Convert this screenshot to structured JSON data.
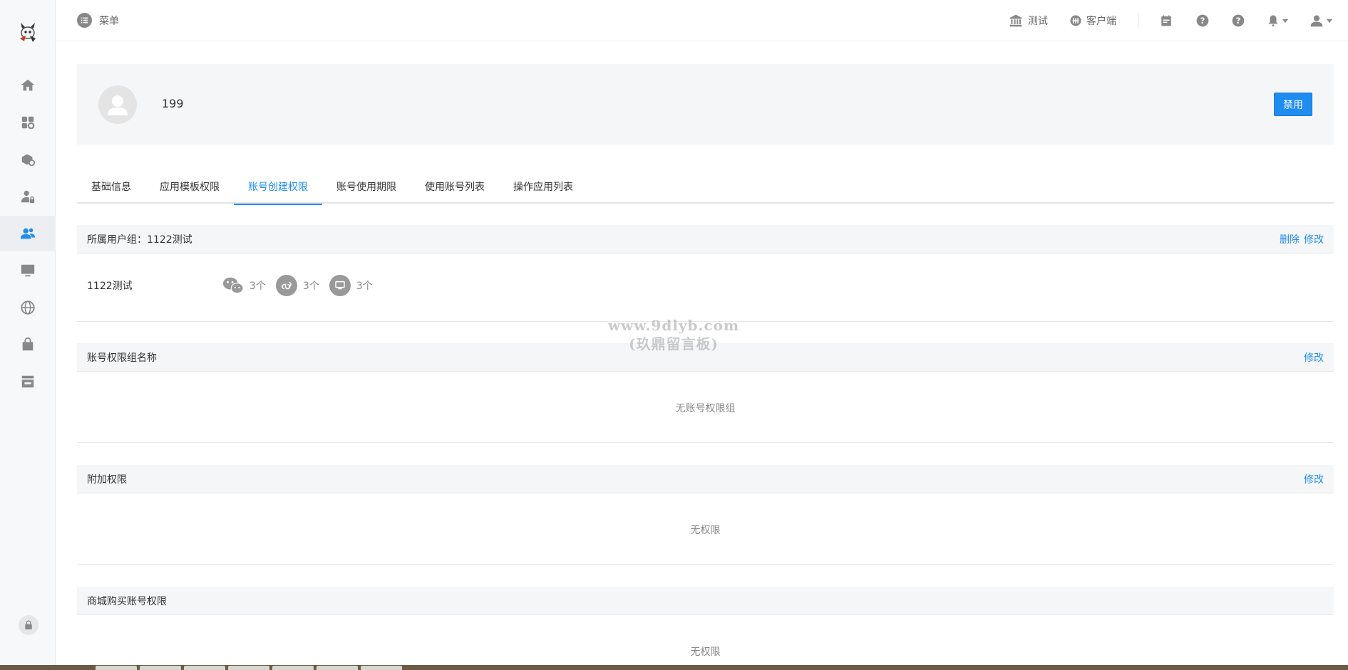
{
  "header": {
    "menu_label": "菜单",
    "links": [
      {
        "label": "测试",
        "icon": "bank-icon"
      },
      {
        "label": "客户端",
        "icon": "client-icon"
      }
    ]
  },
  "sidebar": {
    "items": [
      {
        "name": "home-icon"
      },
      {
        "name": "apps-settings-icon"
      },
      {
        "name": "package-settings-icon"
      },
      {
        "name": "user-lock-icon"
      },
      {
        "name": "users-icon",
        "active": true
      },
      {
        "name": "monitor-icon"
      },
      {
        "name": "globe-icon"
      },
      {
        "name": "bag-icon"
      },
      {
        "name": "store-icon"
      }
    ]
  },
  "profile": {
    "name": "199",
    "disable_label": "禁用"
  },
  "tabs": [
    {
      "label": "基础信息"
    },
    {
      "label": "应用模板权限"
    },
    {
      "label": "账号创建权限",
      "active": true
    },
    {
      "label": "账号使用期限"
    },
    {
      "label": "使用账号列表"
    },
    {
      "label": "操作应用列表"
    }
  ],
  "sections": {
    "group": {
      "title": "所属用户组：1122测试",
      "delete_label": "删除",
      "edit_label": "修改",
      "row_name": "1122测试",
      "caps": [
        {
          "icon": "wechat-icon",
          "count": "3个"
        },
        {
          "icon": "miniprogram-icon",
          "count": "3个"
        },
        {
          "icon": "pc-icon",
          "count": "3个"
        }
      ]
    },
    "perm_group": {
      "title": "账号权限组名称",
      "edit_label": "修改",
      "empty": "无账号权限组"
    },
    "extra": {
      "title": "附加权限",
      "edit_label": "修改",
      "empty": "无权限"
    },
    "mall": {
      "title": "商城购买账号权限",
      "empty": "无权限"
    }
  },
  "watermark": {
    "line1": "www.9dlyb.com",
    "line2": "(玖鼎留言板)"
  },
  "colors": {
    "accent": "#1e8cf0",
    "sidebar_bg": "#f7f8fa",
    "section_bg": "#f5f6f8"
  }
}
